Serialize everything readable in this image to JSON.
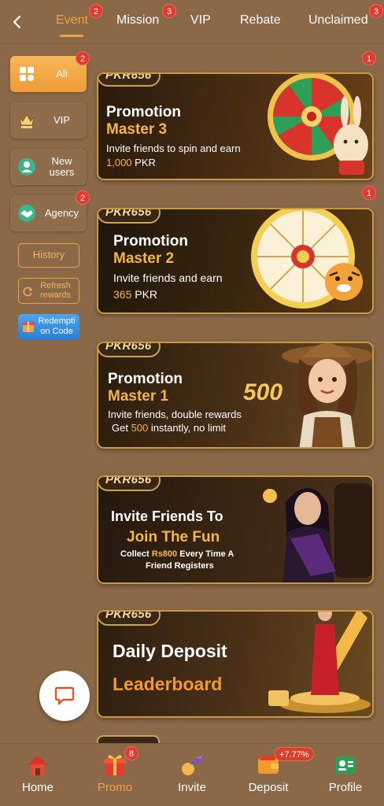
{
  "tabs": [
    {
      "label": "Event",
      "badge": "2",
      "active": true
    },
    {
      "label": "Mission",
      "badge": "3"
    },
    {
      "label": "VIP"
    },
    {
      "label": "Rebate"
    },
    {
      "label": "Unclaimed",
      "badge": "3"
    }
  ],
  "sidebar": {
    "items": [
      {
        "label": "All",
        "badge": "2",
        "active": true
      },
      {
        "label": "VIP"
      },
      {
        "label": "New users"
      },
      {
        "label": "Agency",
        "badge": "2"
      }
    ],
    "history_label": "History",
    "refresh_label": "Refresh rewards",
    "redeem_label": "Redempti on Code"
  },
  "banners": [
    {
      "pill": "PKR656",
      "title1": "Promotion",
      "title2": "Master 3",
      "line1": "Invite friends to spin and earn",
      "amount": "1,000",
      "unit": "PKR",
      "badge": "1"
    },
    {
      "pill": "PKR656",
      "title1": "Promotion",
      "title2": "Master 2",
      "line1": "Invite friends and earn",
      "amount": "365",
      "unit": "PKR",
      "badge": "1"
    },
    {
      "pill": "PKR656",
      "title1": "Promotion",
      "title2": "Master 1",
      "line1": "Invite friends, double rewards",
      "line2_pre": "Get",
      "amount": "500",
      "line2_post": "instantly, no limit",
      "big_number": "500"
    },
    {
      "pill": "PKR656",
      "title1": "Invite Friends To",
      "title2": "Join The Fun",
      "line1_pre": "Collect",
      "amount": "Rs800",
      "line1_post": "Every Time A",
      "line2": "Friend Registers"
    },
    {
      "pill": "PKR656",
      "title1": "Daily Deposit",
      "title2": "Leaderboard"
    }
  ],
  "bottom_nav": {
    "items": [
      {
        "label": "Home"
      },
      {
        "label": "Promo",
        "badge": "8",
        "active": true
      },
      {
        "label": "Invite"
      },
      {
        "label": "Deposit",
        "badge": "+7.77%"
      },
      {
        "label": "Profile"
      }
    ]
  },
  "colors": {
    "background": "#8a6848",
    "accent": "#f2a23a",
    "badge": "#e23a2c",
    "gold_text": "#f4b741"
  },
  "icons": [
    "back-arrow-icon",
    "grid-icon",
    "crown-icon",
    "new-user-icon",
    "handshake-icon",
    "refresh-icon",
    "gift-box-icon",
    "chat-icon",
    "home-icon",
    "gift-icon",
    "invite-icon",
    "wallet-icon",
    "profile-card-icon"
  ]
}
